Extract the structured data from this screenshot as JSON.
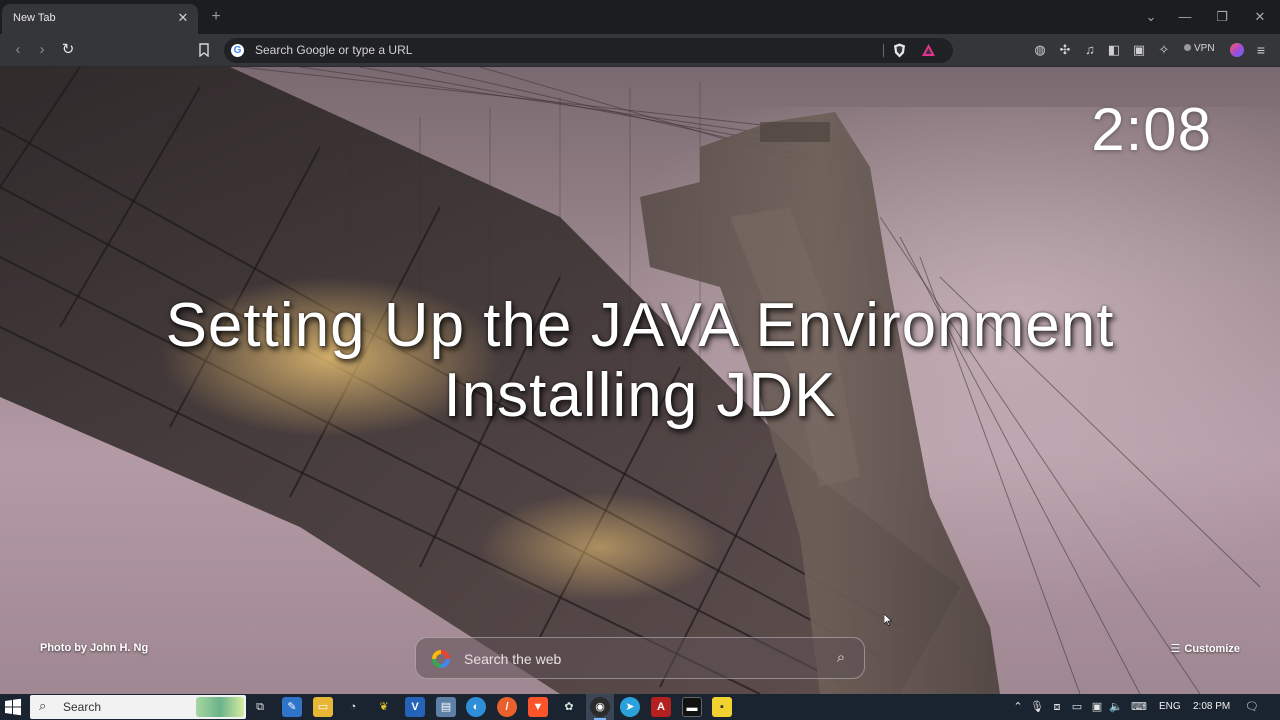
{
  "browser": {
    "tab": {
      "title": "New Tab",
      "close_icon": "✕"
    },
    "new_tab_icon": "+",
    "window_controls": {
      "tabs_menu": "⌄",
      "minimize": "—",
      "restore": "❐",
      "close": "✕"
    },
    "toolbar": {
      "back_icon": "‹",
      "forward_icon": "›",
      "reload_icon": "↻",
      "bookmark_icon": "☐",
      "omnibox_placeholder": "Search Google or type a URL",
      "vpn_label": "VPN",
      "icons": [
        "globe-icon",
        "extensions-icon",
        "media-icon",
        "sidebar-icon",
        "wallet-icon",
        "leo-ai-icon",
        "vpn-icon",
        "profile-icon",
        "menu-icon"
      ]
    }
  },
  "newtab": {
    "clock": "2:08",
    "headline_line1": "Setting Up the JAVA Environment",
    "headline_line2": "Installing JDK",
    "photo_credit": "Photo by John H. Ng",
    "customize_label": "Customize",
    "search_placeholder": "Search the web"
  },
  "taskbar": {
    "search_label": "Search",
    "language": "ENG",
    "time": "2:08 PM",
    "apps": [
      "task-view",
      "notes",
      "file-explorer",
      "app-circle",
      "app-leaf",
      "vscode",
      "app-doc",
      "app-blue",
      "app-orange",
      "brave",
      "app-green",
      "chrome-like",
      "telegram",
      "pdf",
      "terminal",
      "sticky-notes"
    ]
  },
  "colors": {
    "toolbar": "#35363a",
    "tab_strip": "#1c1d20",
    "omnibox": "#202124",
    "taskbar": "#1a2430",
    "brave_orange": "#fb542b"
  }
}
